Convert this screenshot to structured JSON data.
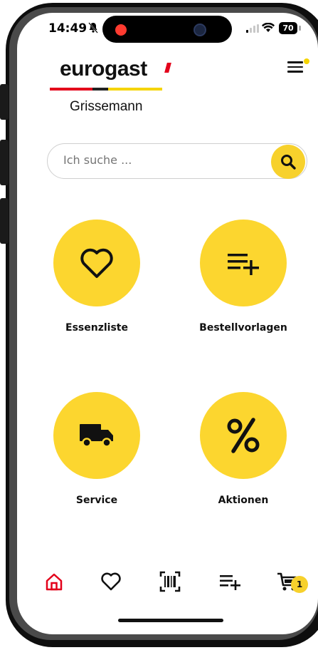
{
  "status_bar": {
    "time": "14:49",
    "battery": "70"
  },
  "brand": {
    "logo": "eurogast",
    "store": "Grissemann"
  },
  "search": {
    "placeholder": "Ich suche ..."
  },
  "tiles": [
    {
      "label": "Essenzliste",
      "icon": "heart-icon"
    },
    {
      "label": "Bestellvorlagen",
      "icon": "list-add-icon"
    },
    {
      "label": "Service",
      "icon": "truck-icon"
    },
    {
      "label": "Aktionen",
      "icon": "percent-icon"
    }
  ],
  "tabbar": {
    "items": [
      "home-icon",
      "heart-icon",
      "barcode-icon",
      "list-add-icon",
      "cart-icon"
    ],
    "cart_count": "1"
  },
  "colors": {
    "accent": "#fcd62f",
    "red": "#e3001b",
    "stripe_yellow": "#f5d400"
  }
}
